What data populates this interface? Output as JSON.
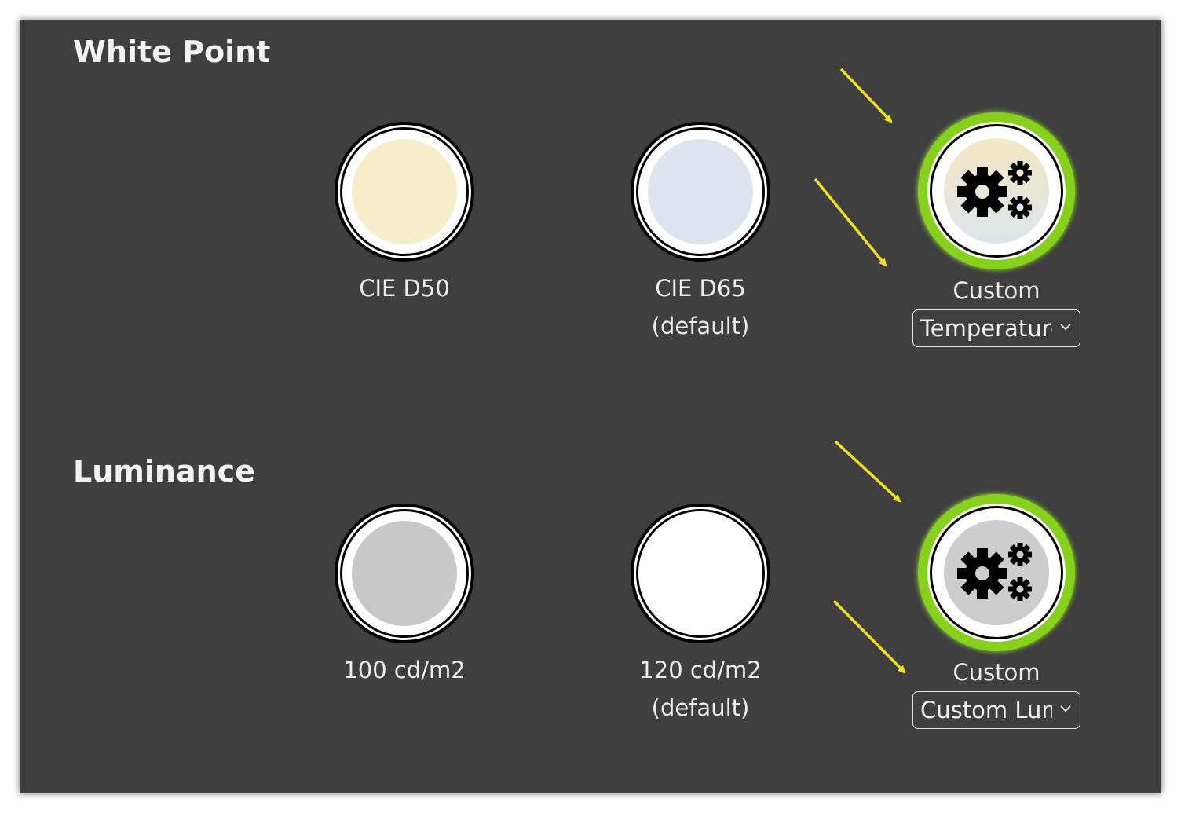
{
  "sections": [
    {
      "title": "White Point",
      "options": [
        {
          "label": "CIE D50",
          "sublabel": "",
          "fill": "#f8edcb"
        },
        {
          "label": "CIE D65",
          "sublabel": "(default)",
          "fill": "#dce5ed"
        },
        {
          "label": "Custom",
          "sublabel": "",
          "selected": true,
          "icon": "gears-icon",
          "dropdown": "Temperature"
        }
      ]
    },
    {
      "title": "Luminance",
      "options": [
        {
          "label": "100 cd/m2",
          "sublabel": "",
          "fill": "#c8c8c8"
        },
        {
          "label": "120 cd/m2",
          "sublabel": "(default)",
          "fill": "#ffffff"
        },
        {
          "label": "Custom",
          "sublabel": "",
          "selected": true,
          "icon": "gears-icon",
          "dropdown": "Custom Luminance"
        }
      ]
    }
  ],
  "colors": {
    "panel": "#3f3f3f",
    "selection_ring": "#86d11c",
    "annotation_arrow": "#f0e020"
  }
}
